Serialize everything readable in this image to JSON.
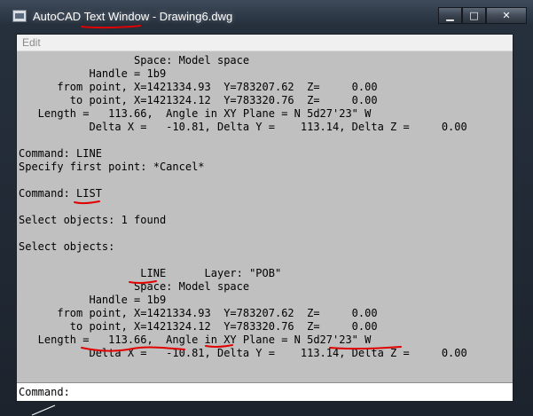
{
  "window": {
    "title": "AutoCAD Text Window - Drawing6.dwg",
    "minimize_glyph": "▁",
    "maximize_glyph": "□",
    "close_glyph": "✕"
  },
  "menu": {
    "edit_label": "Edit"
  },
  "output_lines": [
    "                  Space: Model space",
    "           Handle = 1b9",
    "      from point, X=1421334.93  Y=783207.62  Z=     0.00",
    "        to point, X=1421324.12  Y=783320.76  Z=     0.00",
    "   Length =   113.66,  Angle in XY Plane = N 5d27'23\" W",
    "           Delta X =   -10.81, Delta Y =    113.14, Delta Z =     0.00",
    "",
    "Command: LINE",
    "Specify first point: *Cancel*",
    "",
    "Command: LIST",
    "",
    "Select objects: 1 found",
    "",
    "Select objects:",
    "",
    "                   LINE      Layer: \"POB\"",
    "                  Space: Model space",
    "           Handle = 1b9",
    "      from point, X=1421334.93  Y=783207.62  Z=     0.00",
    "        to point, X=1421324.12  Y=783320.76  Z=     0.00",
    "   Length =   113.66,  Angle in XY Plane = N 5d27'23\" W",
    "           Delta X =   -10.81, Delta Y =    113.14, Delta Z =     0.00"
  ],
  "command_prompt": "Command:",
  "annotation_color": "#e00000"
}
